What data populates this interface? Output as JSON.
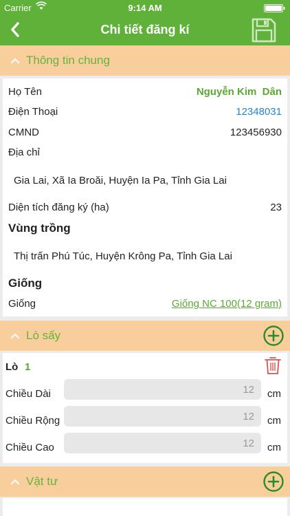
{
  "status_bar": {
    "carrier": "Carrier",
    "time": "9:14 AM"
  },
  "nav": {
    "title": "Chi tiết đăng kí"
  },
  "info_section": {
    "header": "Thông tin chung",
    "ho_ten_label": "Họ Tên",
    "ho_ten_value": "Nguyễn Kim  Dân",
    "dien_thoai_label": "Điện Thoại",
    "dien_thoai_value": "12348031",
    "cmnd_label": "CMND",
    "cmnd_value": "123456930",
    "dia_chi_label": "Địa chỉ",
    "dia_chi_value": "Gia Lai, Xã Ia Broăi, Huyện Ia Pa, Tỉnh Gia Lai",
    "dien_tich_label": "Diện tích đăng ký (ha)",
    "dien_tich_value": "23",
    "vung_trong_title": "Vùng trồng",
    "vung_trong_value": "Thị trấn Phú Túc, Huyện Krông Pa, Tỉnh Gia Lai",
    "giong_title": "Giống",
    "giong_label": "Giống",
    "giong_value": "Giống NC 100(12 gram)"
  },
  "lo_say_section": {
    "header": "Lò sấy",
    "lo_label": "Lò",
    "lo_number": "1",
    "chieu_dai_label": "Chiều Dài",
    "chieu_dai_value": "12",
    "chieu_rong_label": "Chiều Rộng",
    "chieu_rong_value": "12",
    "chieu_cao_label": "Chiều Cao",
    "chieu_cao_value": "12",
    "unit": "cm"
  },
  "vat_tu_section": {
    "header": "Vật tư"
  },
  "colors": {
    "primary_green": "#5fb13a",
    "section_bg": "#f8cf9c",
    "link_blue": "#1e86d6",
    "trash_red": "#d9534f"
  }
}
